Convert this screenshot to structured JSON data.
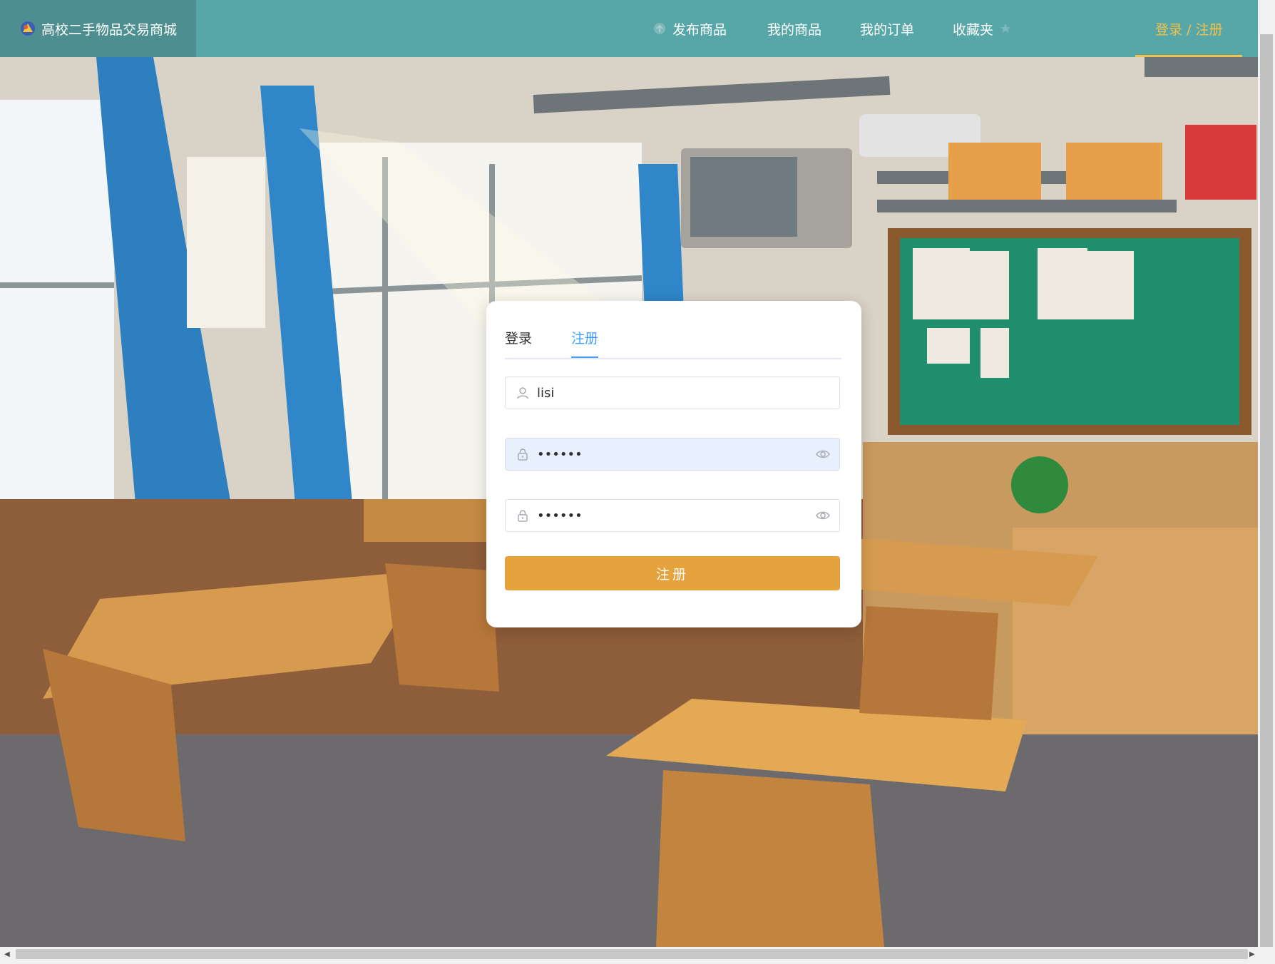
{
  "header": {
    "brand": "高校二手物品交易商城",
    "nav": [
      {
        "label": "发布商品",
        "icon": "publish-icon"
      },
      {
        "label": "我的商品"
      },
      {
        "label": "我的订单"
      },
      {
        "label": "收藏夹",
        "icon": "star-icon"
      }
    ],
    "login": "登录 / 注册"
  },
  "form": {
    "tabs": [
      "登录",
      "注册"
    ],
    "active_tab": "注册",
    "username": {
      "value": "lisi"
    },
    "password": {
      "value": "123456"
    },
    "confirm_password": {
      "value": "123456"
    },
    "submit": "注册"
  },
  "colors": {
    "header": "#58a7a8",
    "brand_bg": "#4d8f90",
    "accent_link": "#f2c24b",
    "tab_active": "#409eff",
    "submit": "#e6a23c"
  }
}
